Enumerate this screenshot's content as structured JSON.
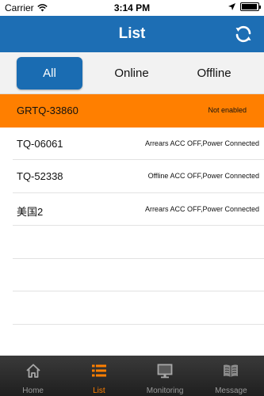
{
  "status_bar": {
    "carrier": "Carrier",
    "time": "3:14 PM",
    "battery_level": 0.95
  },
  "header": {
    "title": "List"
  },
  "filters": [
    {
      "label": "All",
      "active": true
    },
    {
      "label": "Online",
      "active": false
    },
    {
      "label": "Offline",
      "active": false
    }
  ],
  "devices": [
    {
      "name": "GRTQ-33860",
      "status": "Not enabled"
    },
    {
      "name": "TQ-06061",
      "status": "Arrears ACC OFF,Power Connected"
    },
    {
      "name": "TQ-52338",
      "status": "Offline ACC OFF,Power Connected"
    },
    {
      "name": "美国2",
      "status": "Arrears ACC OFF,Power Connected"
    }
  ],
  "tabs": [
    {
      "label": "Home",
      "icon": "home-icon"
    },
    {
      "label": "List",
      "icon": "list-icon"
    },
    {
      "label": "Monitoring",
      "icon": "monitor-icon"
    },
    {
      "label": "Message",
      "icon": "book-icon"
    }
  ],
  "colors": {
    "header": "#1d6eb4",
    "accent": "#ff7f00",
    "tabbar": "#2a2a2a"
  }
}
